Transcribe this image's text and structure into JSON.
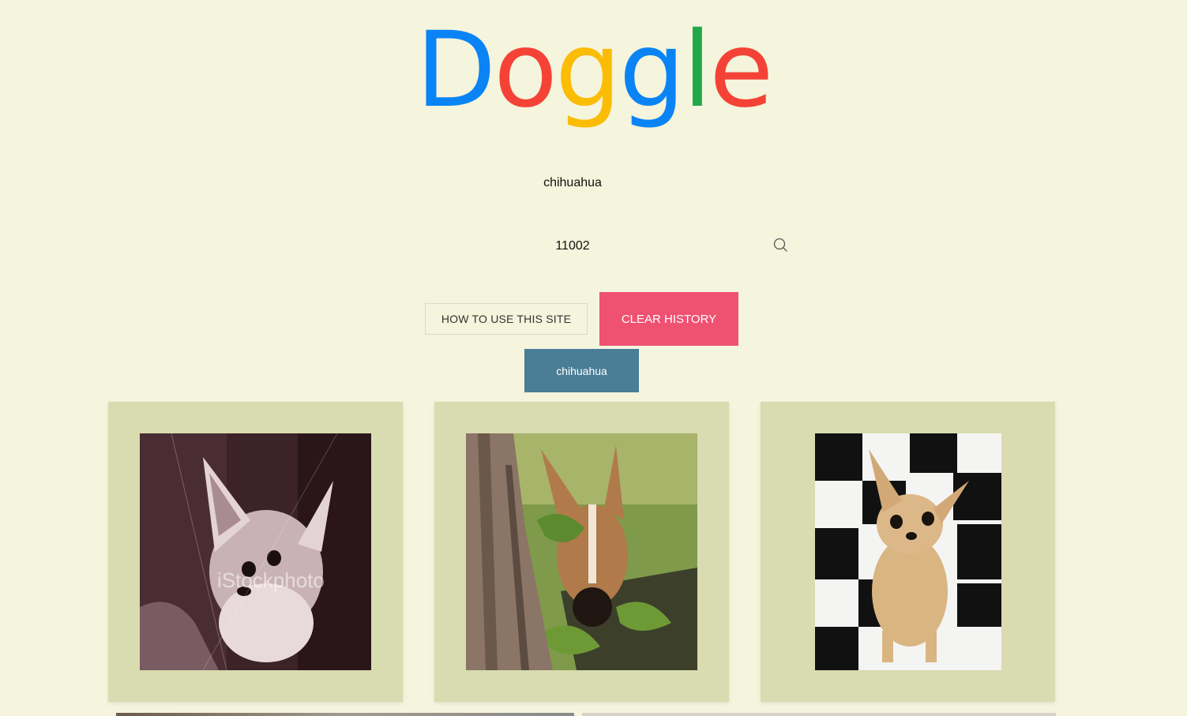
{
  "logo": {
    "letters": [
      "D",
      "o",
      "g",
      "g",
      "l",
      "e"
    ],
    "colors": [
      "#0a84f5",
      "#f44336",
      "#fbbc05",
      "#0a84f5",
      "#22a84a",
      "#f44336"
    ]
  },
  "search": {
    "breed_value": "chihuahua",
    "zip_value": "11002",
    "icon": "search-icon"
  },
  "buttons": {
    "help_label": "HOW TO USE THIS SITE",
    "clear_label": "CLEAR HISTORY",
    "history_items": [
      "chihuahua"
    ]
  },
  "colors": {
    "background": "#f5f4dc",
    "card": "#d9dbb0",
    "clear_button": "#ef5171",
    "history_button": "#4a7d96"
  },
  "cards": [
    {
      "subject": "chihuahua-photo-1",
      "watermark": "iStockphoto"
    },
    {
      "subject": "chihuahua-photo-2"
    },
    {
      "subject": "chihuahua-photo-3"
    }
  ]
}
